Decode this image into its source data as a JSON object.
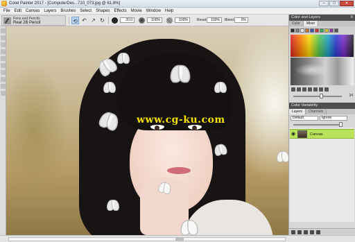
{
  "window": {
    "title": "Corel Painter 2017 - [ComputerDes...710_073.jpg @ 61,8%]",
    "minimize": "–",
    "maximize": "□",
    "close": "✕"
  },
  "menu": [
    "File",
    "Edit",
    "Canvas",
    "Layers",
    "Brushes",
    "Select",
    "Shapes",
    "Effects",
    "Movie",
    "Window",
    "Help"
  ],
  "property_bar": {
    "brush_category": "Pens and Pencils",
    "brush_variant": "Real 2B Pencil",
    "size_value": "20.0",
    "opacity_value": "100%",
    "grain_value": "100%",
    "resat_label": "Resat:",
    "resat_value": "100%",
    "bleed_label": "Bleed:",
    "bleed_value": "0%"
  },
  "canvas": {
    "watermark": "www.cg-ku.com"
  },
  "panel": {
    "title": "Color and Layers",
    "tabs": [
      "Color",
      "Mixer"
    ],
    "active_tab": "Mixer",
    "swatch_colors": [
      "#2a2a2a",
      "#7d7d7d",
      "#e8e8e8",
      "#b8763b",
      "#3a5aa8",
      "#c83a3a",
      "#3aa85a",
      "#d8c23a",
      "#8a3aa8",
      "#555555"
    ],
    "brush_size_value": "24",
    "color_variability": "Color Variability",
    "layer_tabs": [
      "Layers",
      "Channels"
    ],
    "composite_mode": "Default",
    "method": "Ignore",
    "layer_name": "Canvas"
  }
}
